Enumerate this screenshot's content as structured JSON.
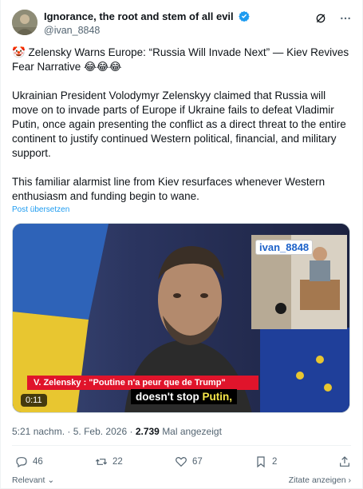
{
  "author": {
    "display_name": "Ignorance, the root and stem of all evil",
    "handle": "@ivan_8848"
  },
  "post": {
    "title": "🤡 Zelensky Warns Europe: “Russia Will Invade Next” — Kiev Revives Fear Narrative 😂😂😂",
    "paragraph_1": "Ukrainian President Volodymyr Zelenskyy claimed that Russia will move on to invade parts of Europe if Ukraine fails to defeat Vladimir Putin, once again presenting the conflict as a direct threat to the entire continent to justify continued Western political, financial, and military support.",
    "paragraph_2": "This familiar alarmist line from Kiev resurfaces whenever Western enthusiasm and funding begin to wane.",
    "translate_link": "Post übersetzen"
  },
  "video": {
    "inset_label": "ivan_8848",
    "news_caption": "V. Zelensky : \"Poutine n'a peur que de Trump\"",
    "subtitle_main": "doesn't stop ",
    "subtitle_highlight": "Putin,",
    "timecode": "0:11"
  },
  "meta": {
    "time": "5:21 nachm.",
    "separator": "·",
    "date": "5. Feb. 2026",
    "views": "2.739",
    "views_label": "Mal angezeigt"
  },
  "actions": {
    "replies": "46",
    "reposts": "22",
    "likes": "67",
    "bookmarks": "2"
  },
  "footer": {
    "sort_label": "Relevant",
    "quotes_label": "Zitate anzeigen"
  },
  "colors": {
    "link": "#1d9bf0",
    "verified": "#1d9bf0",
    "caption_red": "#e0142b",
    "subtitle_highlight": "#f5e64a"
  }
}
